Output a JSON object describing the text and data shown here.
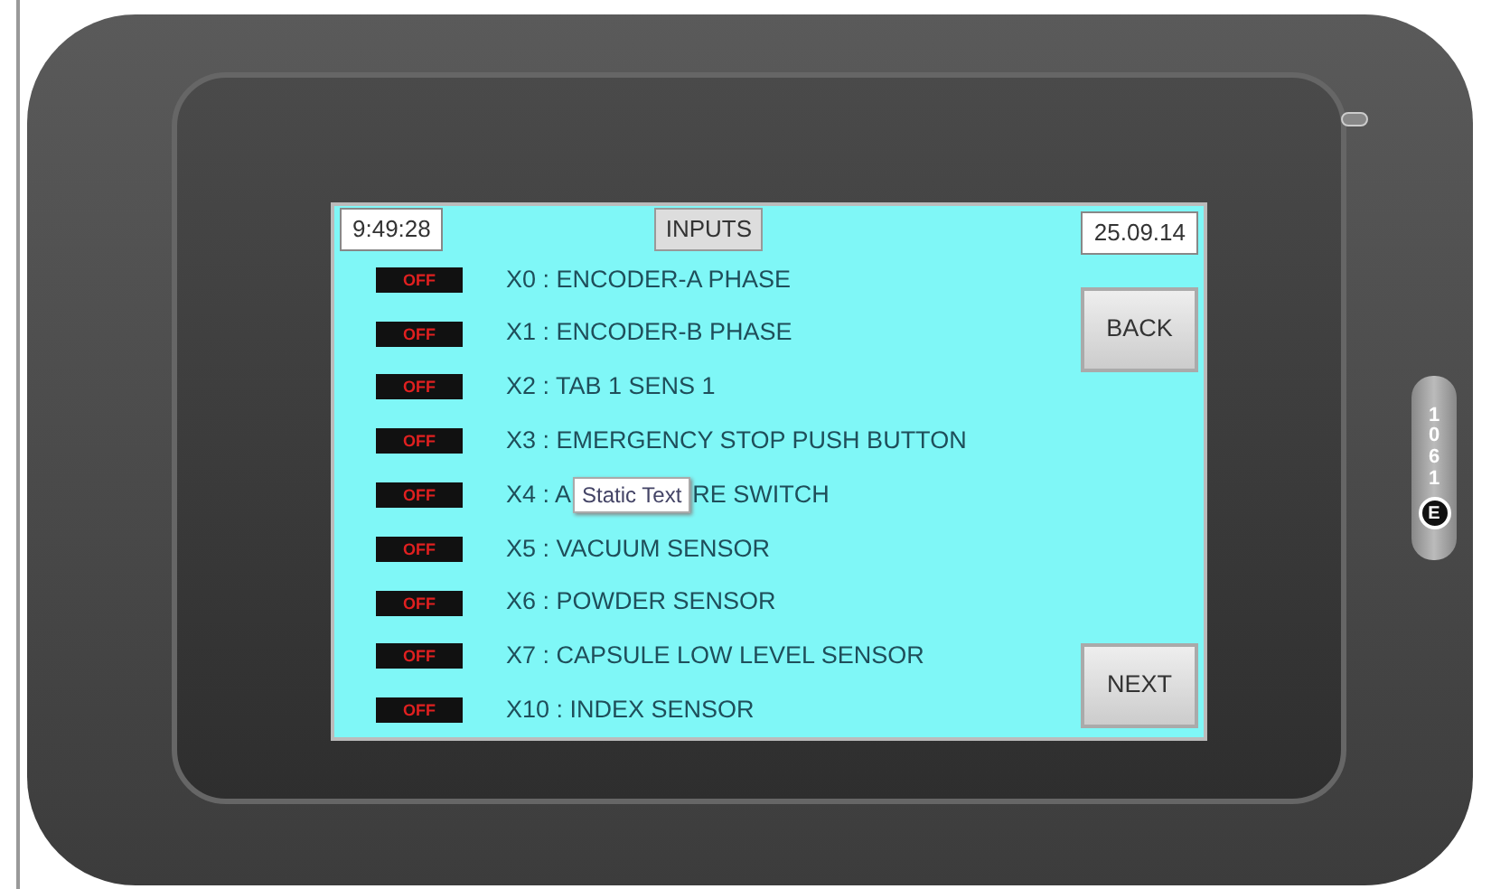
{
  "screen": {
    "time": "9:49:28",
    "title_button": "INPUTS",
    "date": "25.09.14"
  },
  "inputs": [
    {
      "state": "OFF",
      "on": false,
      "label": "X0 : ENCODER-A PHASE"
    },
    {
      "state": "OFF",
      "on": false,
      "label": "X1 : ENCODER-B PHASE"
    },
    {
      "state": "OFF",
      "on": false,
      "label": "X2 : TAB 1 SENS 1"
    },
    {
      "state": "OFF",
      "on": false,
      "label": "X3 : EMERGENCY STOP PUSH BUTTON"
    },
    {
      "state": "OFF",
      "on": false,
      "label": "X4 : A",
      "tooltip": "Static Text",
      "label_after": "RE SWITCH"
    },
    {
      "state": "OFF",
      "on": false,
      "label": "X5 : VACUUM SENSOR"
    },
    {
      "state": "OFF",
      "on": false,
      "label": "X6 : POWDER SENSOR"
    },
    {
      "state": "OFF",
      "on": false,
      "label": "X7 : CAPSULE LOW LEVEL SENSOR"
    },
    {
      "state": "OFF",
      "on": false,
      "label": "X10 : INDEX SENSOR"
    }
  ],
  "buttons": {
    "back": "BACK",
    "next": "NEXT"
  },
  "device": {
    "logo_letter": "E",
    "logo_text": "1061"
  }
}
